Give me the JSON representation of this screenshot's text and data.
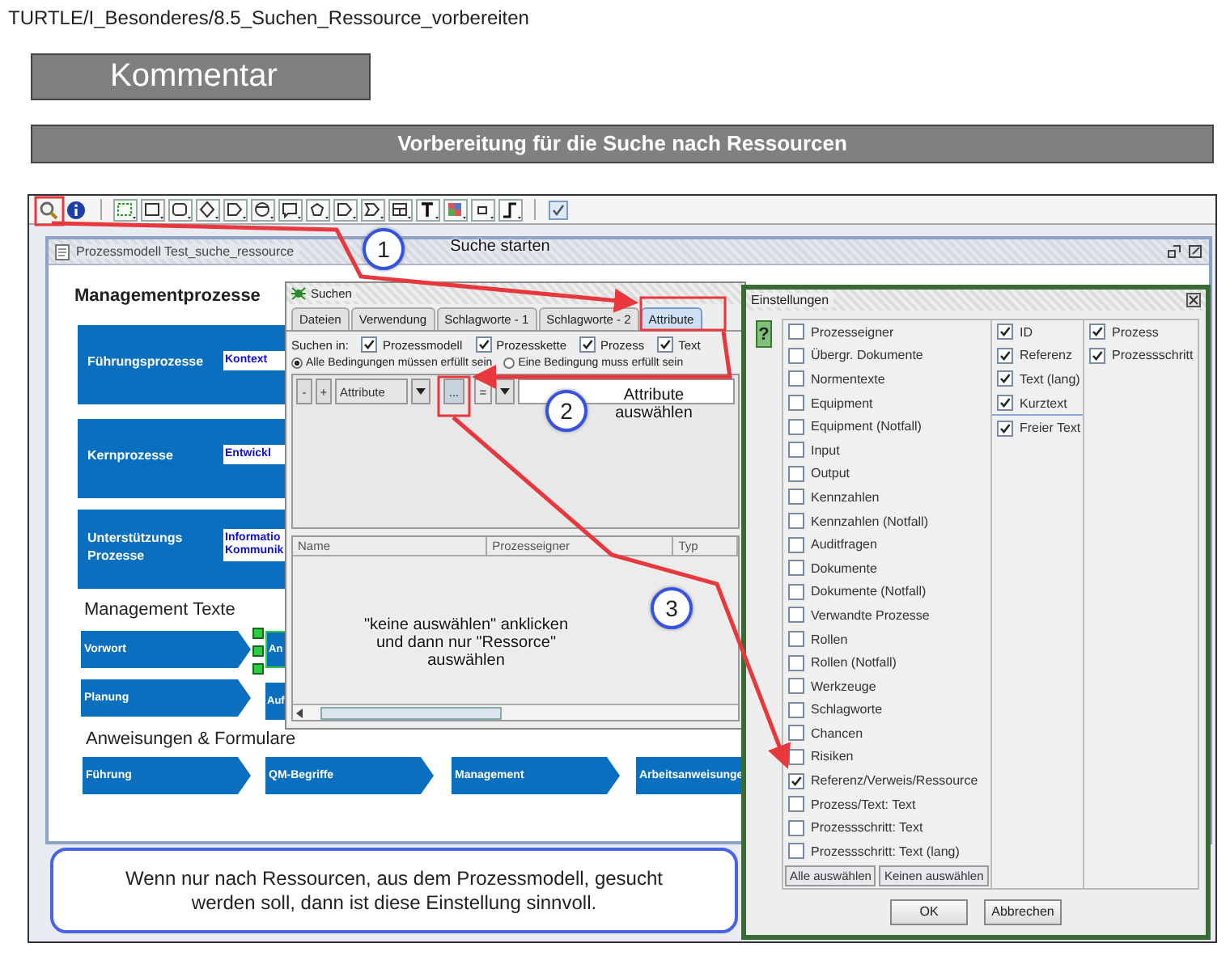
{
  "breadcrumb": "TURTLE/I_Besonderes/8.5_Suchen_Ressource_vorbereiten",
  "comment_heading": "Kommentar",
  "section_title": "Vorbereitung für die Suche nach Ressourcen",
  "model_window": {
    "title": "Prozessmodell Test_suche_ressource",
    "headings": [
      "Managementprozesse",
      "Management Texte",
      "Anweisungen & Formulare"
    ],
    "process_blocks": [
      {
        "label": "Führungsprozesse",
        "inner": [
          "Kontext"
        ]
      },
      {
        "label": "Kernprozesse",
        "inner": [
          "Entwickl"
        ]
      },
      {
        "label": "Unterstützungs Prozesse",
        "inner": [
          "Informatio",
          "Kommunik"
        ]
      }
    ],
    "text_rows": [
      {
        "label": "Vorwort",
        "next": "An",
        "selected": true
      },
      {
        "label": "Planung",
        "next": "Auf",
        "selected": false
      }
    ],
    "instructions": [
      "Führung",
      "QM-Begriffe",
      "Management",
      "Arbeitsanweisunge"
    ]
  },
  "search_dialog": {
    "title": "Suchen",
    "tabs": [
      {
        "label": "Dateien",
        "selected": false
      },
      {
        "label": "Verwendung",
        "selected": false
      },
      {
        "label": "Schlagworte - 1",
        "selected": false
      },
      {
        "label": "Schlagworte - 2",
        "selected": false
      },
      {
        "label": "Attribute",
        "selected": true
      }
    ],
    "search_in_label": "Suchen in:",
    "search_in": [
      {
        "label": "Prozessmodell",
        "checked": true
      },
      {
        "label": "Prozesskette",
        "checked": true
      },
      {
        "label": "Prozess",
        "checked": true
      },
      {
        "label": "Text",
        "checked": true
      }
    ],
    "conditions": [
      {
        "label": "Alle Bedingungen müssen erfüllt sein",
        "selected": true
      },
      {
        "label": "Eine Bedingung muss erfüllt sein",
        "selected": false
      }
    ],
    "condition_row": {
      "remove": "-",
      "add": "+",
      "attribute": "Attribute",
      "browse": "...",
      "operator": "="
    },
    "result_columns": [
      "Name",
      "Prozesseigner",
      "Typ"
    ]
  },
  "settings_dialog": {
    "title": "Einstellungen",
    "help": "?",
    "attributes": [
      {
        "label": "Prozesseigner",
        "checked": false
      },
      {
        "label": "Übergr. Dokumente",
        "checked": false
      },
      {
        "label": "Normentexte",
        "checked": false
      },
      {
        "label": "Equipment",
        "checked": false
      },
      {
        "label": "Equipment (Notfall)",
        "checked": false
      },
      {
        "label": "Input",
        "checked": false
      },
      {
        "label": "Output",
        "checked": false
      },
      {
        "label": "Kennzahlen",
        "checked": false
      },
      {
        "label": "Kennzahlen (Notfall)",
        "checked": false
      },
      {
        "label": "Auditfragen",
        "checked": false
      },
      {
        "label": "Dokumente",
        "checked": false
      },
      {
        "label": "Dokumente (Notfall)",
        "checked": false
      },
      {
        "label": "Verwandte Prozesse",
        "checked": false
      },
      {
        "label": "Rollen",
        "checked": false
      },
      {
        "label": "Rollen (Notfall)",
        "checked": false
      },
      {
        "label": "Werkzeuge",
        "checked": false
      },
      {
        "label": "Schlagworte",
        "checked": false
      },
      {
        "label": "Chancen",
        "checked": false
      },
      {
        "label": "Risiken",
        "checked": false
      },
      {
        "label": "Referenz/Verweis/Ressource",
        "checked": true
      },
      {
        "label": "Prozess/Text: Text",
        "checked": false
      },
      {
        "label": "Prozessschritt: Text",
        "checked": false
      },
      {
        "label": "Prozessschritt: Text (lang)",
        "checked": false
      }
    ],
    "fields": [
      {
        "label": "ID",
        "checked": true
      },
      {
        "label": "Referenz",
        "checked": true
      },
      {
        "label": "Text (lang)",
        "checked": true
      },
      {
        "label": "Kurztext",
        "checked": true
      }
    ],
    "extra_fields": [
      {
        "label": "Freier Text",
        "checked": true
      }
    ],
    "scopes": [
      {
        "label": "Prozess",
        "checked": true
      },
      {
        "label": "Prozessschritt",
        "checked": true
      }
    ],
    "select_all": "Alle auswählen",
    "select_none": "Keinen auswählen",
    "ok": "OK",
    "cancel": "Abbrechen"
  },
  "annotations": [
    {
      "number": "1",
      "label": "Suche starten"
    },
    {
      "number": "2",
      "label": "Attribute auswählen"
    },
    {
      "number": "3",
      "label": "\"keine auswählen\" anklicken und dann nur \"Ressorce\" auswählen"
    }
  ],
  "note": "Wenn nur nach Ressourcen, aus dem Prozessmodell, gesucht werden soll, dann ist diese Einstellung sinnvoll."
}
